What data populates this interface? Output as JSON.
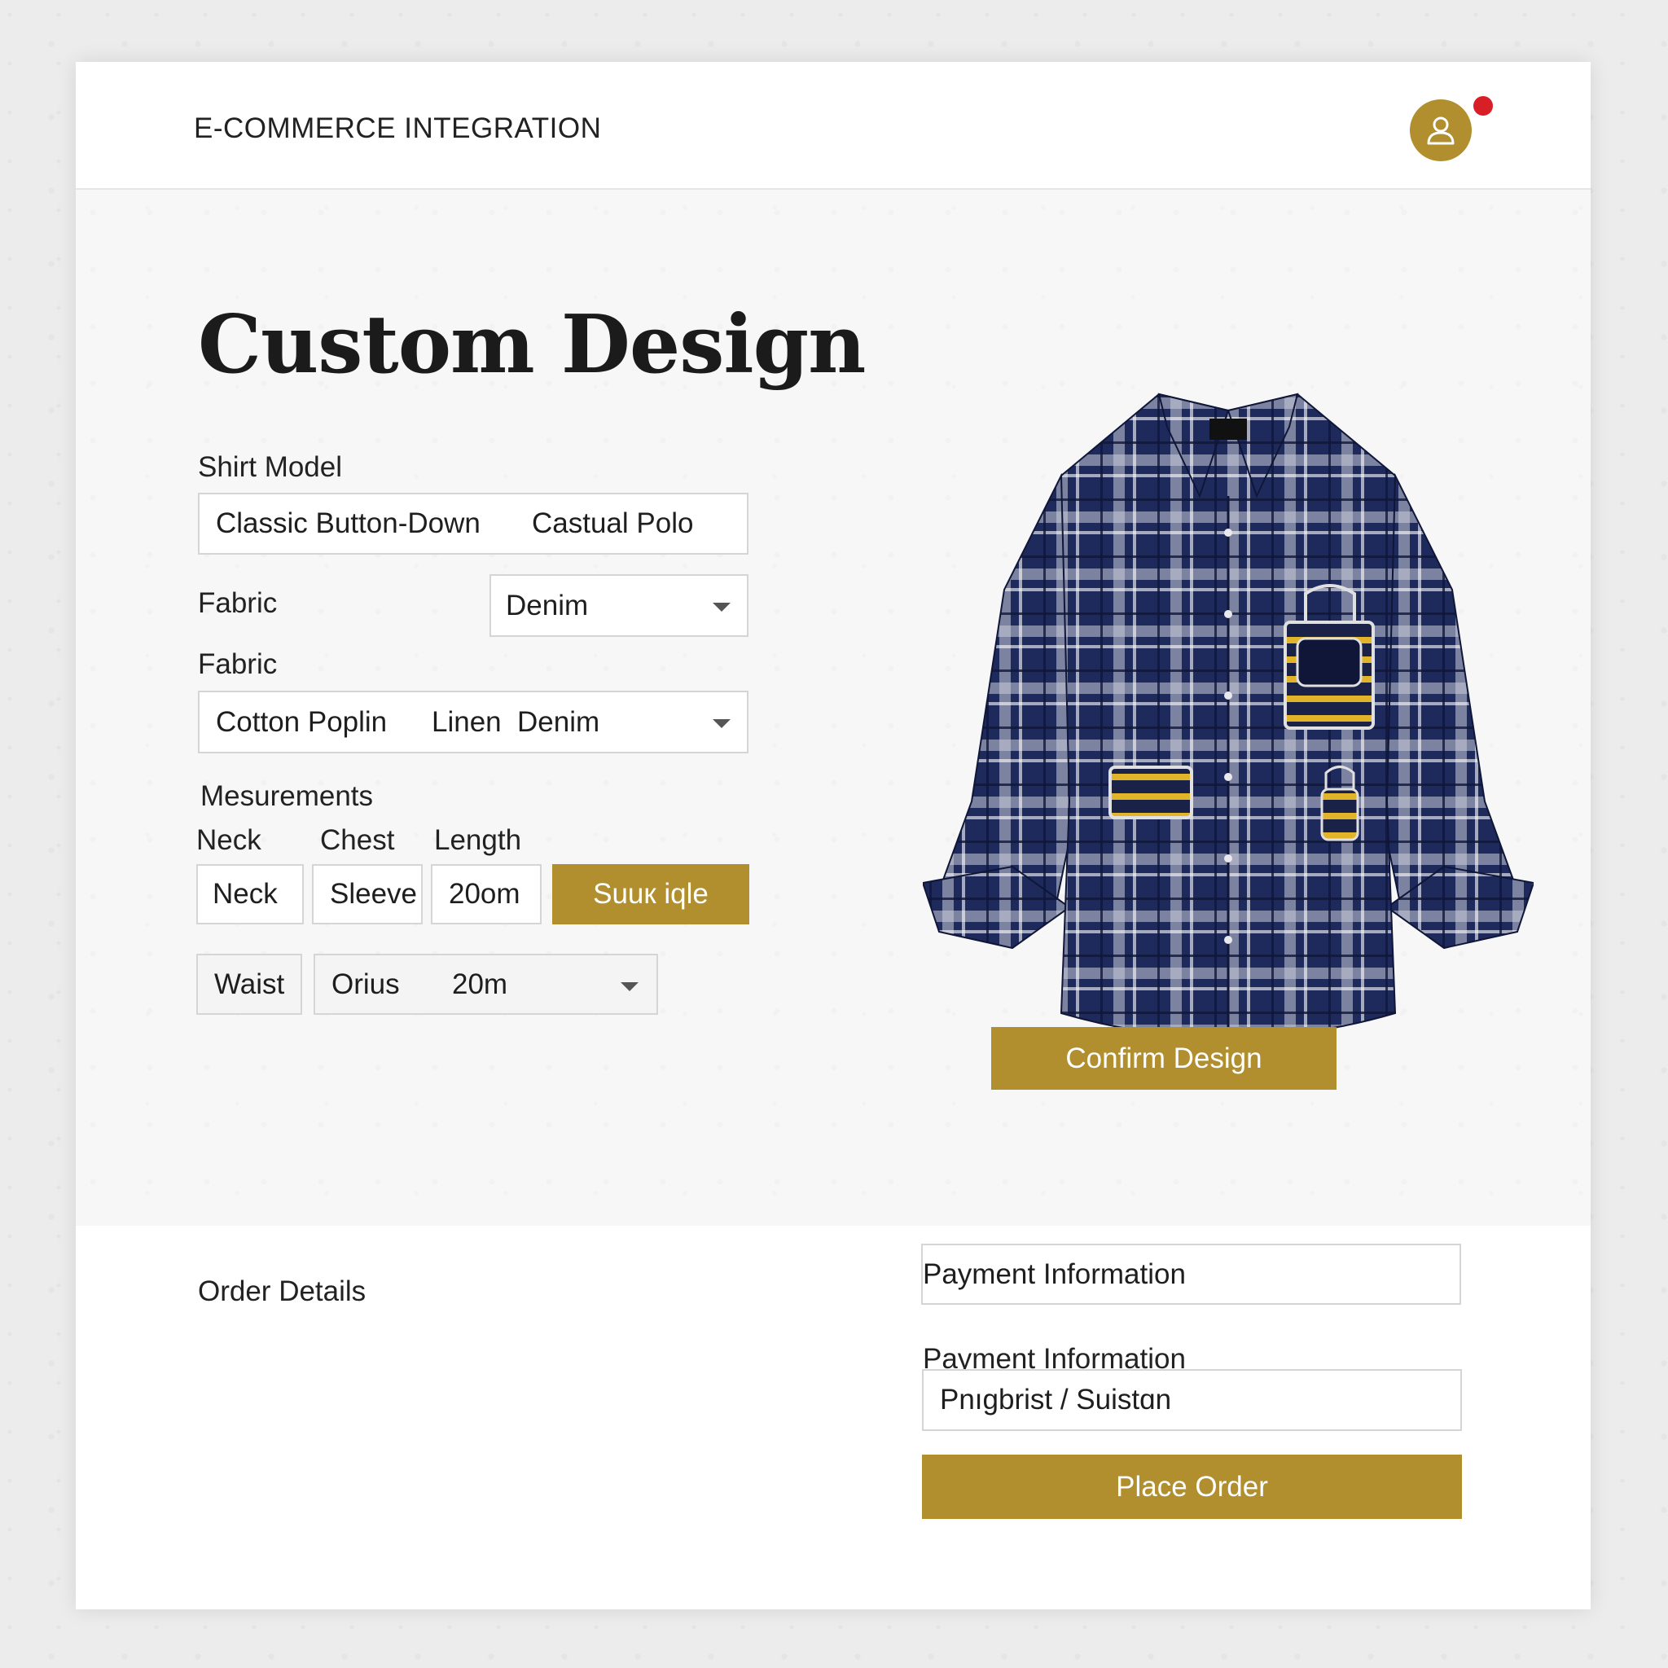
{
  "header": {
    "brand": "E-COMMERCE INTEGRATION"
  },
  "design": {
    "title": "Custom Design",
    "shirt_model": {
      "label": "Shirt Model",
      "options": [
        "Classic Button-Down",
        "Castual Polo"
      ]
    },
    "fabric_select": {
      "label": "Fabric",
      "value": "Denim"
    },
    "fabric_options": {
      "label": "Fabric",
      "options": [
        "Cotton Poplin",
        "Linen",
        "Denim"
      ]
    },
    "measurements": {
      "label": "Mesurements",
      "headers": [
        "Neck",
        "Chest",
        "Length"
      ],
      "fields": [
        "Neck",
        "Sleeve",
        "20om"
      ],
      "submit_label": "Suuк iqle",
      "row2": {
        "waist": "Waist",
        "select_label": "Orius",
        "select_value": "20m"
      }
    },
    "confirm_label": "Confirm Design"
  },
  "order": {
    "title": "Order Details",
    "payment_field_value": "Payment Information",
    "payment_label": "Payment Information",
    "payment_input_value": "Pnıgbrist / Suistɑn",
    "place_order_label": "Place Order"
  },
  "colors": {
    "accent": "#b18f2e",
    "notification": "#d81f26",
    "shirt_navy": "#1e2a5c",
    "pocket_yellow": "#e2b42a"
  },
  "icons": {
    "avatar": "user-icon",
    "dropdown": "chevron-down-icon"
  }
}
